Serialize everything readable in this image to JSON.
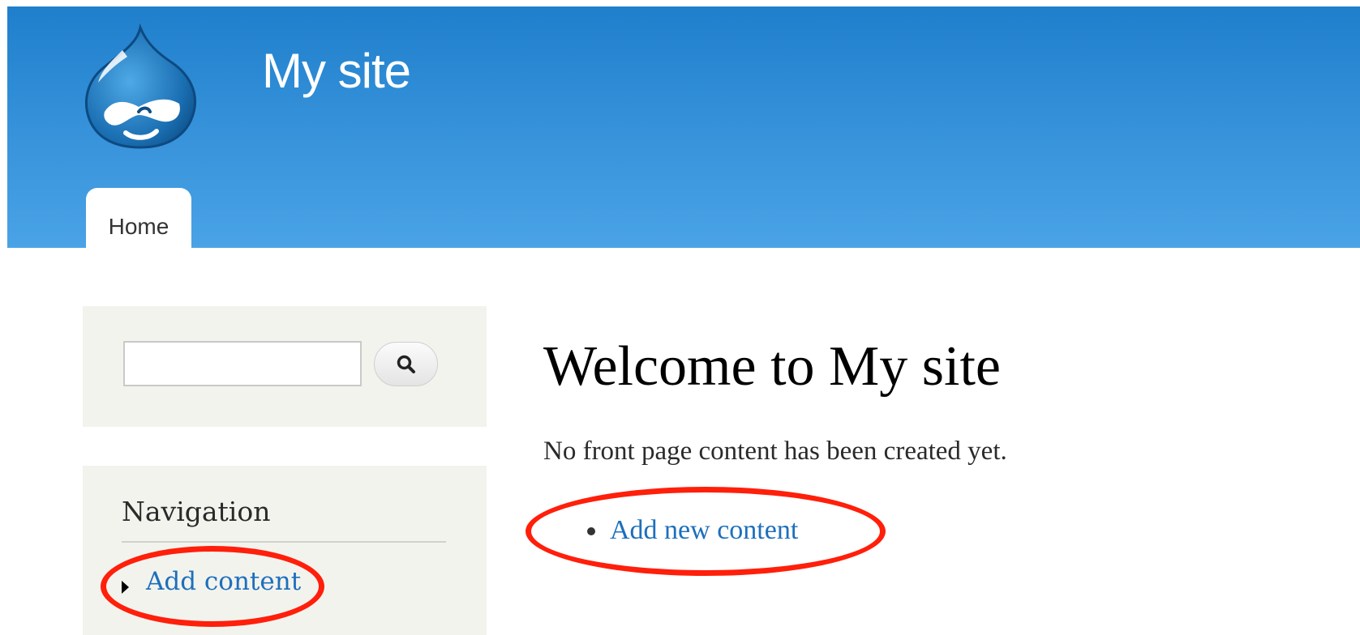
{
  "site": {
    "name": "My site",
    "logo_icon": "drupal-drop-logo-icon"
  },
  "tabs": [
    {
      "label": "Home",
      "active": true
    }
  ],
  "search": {
    "value": "",
    "placeholder": "",
    "button_icon": "search-icon"
  },
  "navigation": {
    "title": "Navigation",
    "items": [
      {
        "label": "Add content",
        "icon": "collapsed-arrow-icon"
      }
    ]
  },
  "main": {
    "title": "Welcome to My site",
    "message": "No front page content has been created yet.",
    "links": [
      {
        "label": "Add new content"
      }
    ]
  },
  "annotations": {
    "color": "#ff1f0a",
    "shape": "ellipse"
  },
  "colors": {
    "header_top": "#1f7fcc",
    "header_bottom": "#4aa3e6",
    "link": "#1d6fbc",
    "sidebar_bg": "#f3f3ee"
  }
}
